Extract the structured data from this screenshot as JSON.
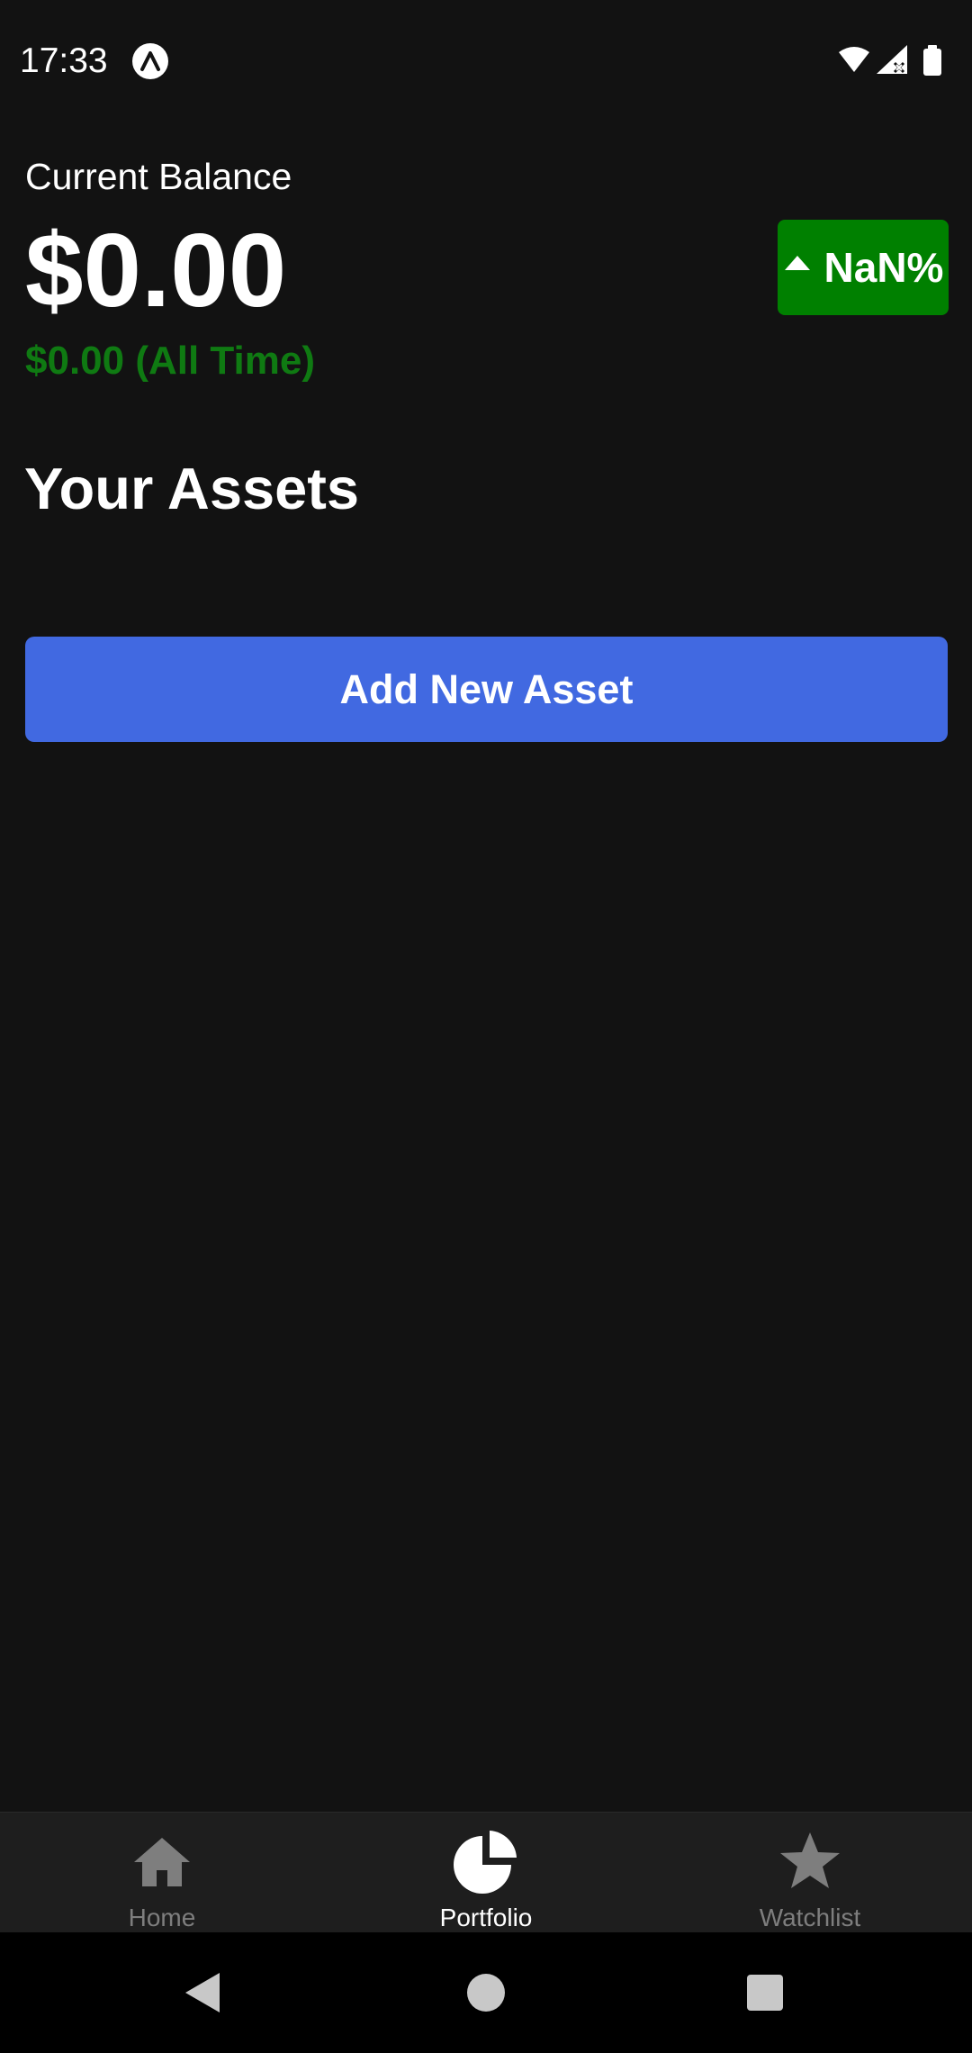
{
  "status_bar": {
    "time": "17:33"
  },
  "portfolio": {
    "balance_label": "Current Balance",
    "balance_value": "$0.00",
    "all_time_change": "$0.00 (All Time)",
    "change_percent": "NaN%",
    "assets_title": "Your Assets",
    "add_button_label": "Add New Asset"
  },
  "tabs": [
    {
      "label": "Home",
      "icon": "home-icon",
      "active": false
    },
    {
      "label": "Portfolio",
      "icon": "pie-chart-icon",
      "active": true
    },
    {
      "label": "Watchlist",
      "icon": "star-icon",
      "active": false
    }
  ],
  "colors": {
    "background": "#121212",
    "positive": "#008000",
    "positive_text": "#0f7a12",
    "accent": "#4169e1",
    "tab_bar": "#1e1e1e",
    "tab_inactive": "#7e7e7e"
  }
}
